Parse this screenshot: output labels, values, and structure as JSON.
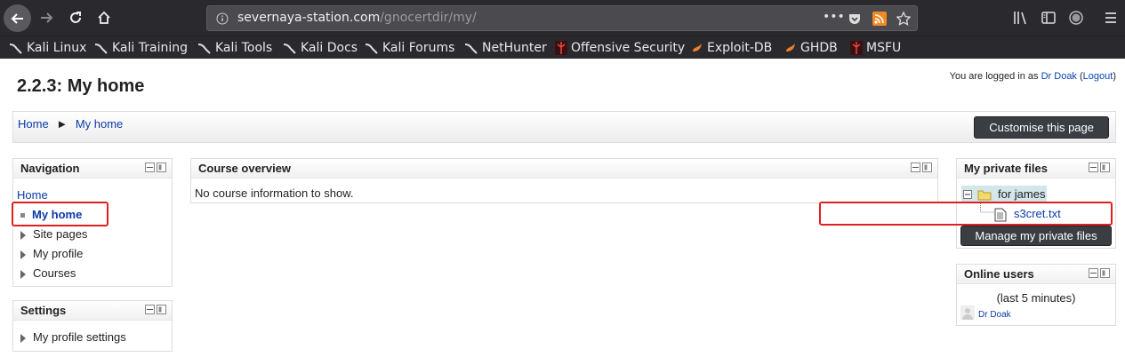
{
  "browser": {
    "url_host": "severnaya-station.com",
    "url_path": "/gnocertdir/my/",
    "bookmarks": [
      "Kali Linux",
      "Kali Training",
      "Kali Tools",
      "Kali Docs",
      "Kali Forums",
      "NetHunter",
      "Offensive Security",
      "Exploit-DB",
      "GHDB",
      "MSFU"
    ]
  },
  "page": {
    "title": "2.2.3: My home",
    "login_prefix": "You are logged in as",
    "user": "Dr Doak",
    "logout": "Logout"
  },
  "breadcrumb": {
    "home": "Home",
    "sep": "►",
    "current": "My home"
  },
  "customise_label": "Customise this page",
  "navigation": {
    "title": "Navigation",
    "home": "Home",
    "my_home": "My home",
    "items": [
      "Site pages",
      "My profile",
      "Courses"
    ]
  },
  "settings": {
    "title": "Settings",
    "item": "My profile settings"
  },
  "course_overview": {
    "title": "Course overview",
    "message": "No course information to show."
  },
  "private_files": {
    "title": "My private files",
    "folder": "for james",
    "file": "s3cret.txt",
    "manage": "Manage my private files"
  },
  "online_users": {
    "title": "Online users",
    "period": "(last 5 minutes)",
    "user": "Dr Doak"
  },
  "colors": {
    "highlight": "#e02020",
    "link": "#0a3aa8",
    "toolbar": "#2a2a2e"
  }
}
